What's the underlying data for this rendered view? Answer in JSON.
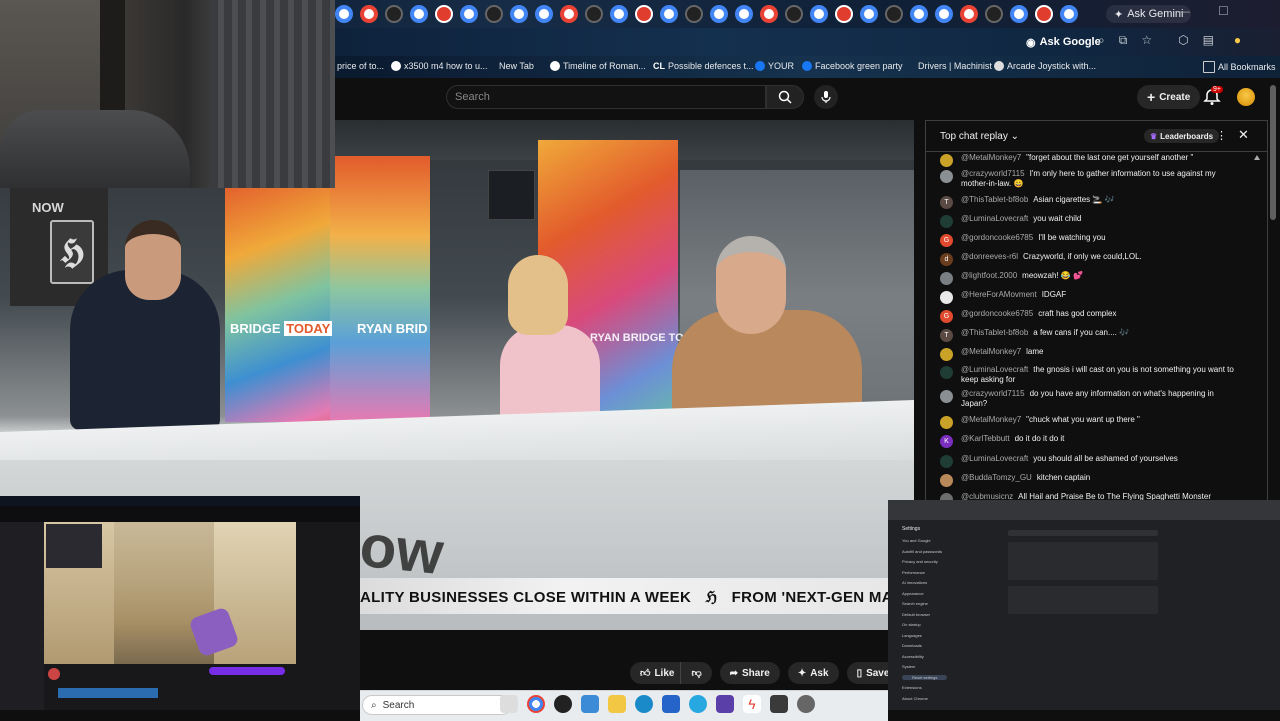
{
  "browser": {
    "tabs_count": 30,
    "ask_gemini": "Ask Gemini",
    "ask_google": "Ask Google",
    "bookmarks": [
      {
        "label": "price of to..."
      },
      {
        "label": "x3500 m4 how to u..."
      },
      {
        "label": "New Tab"
      },
      {
        "label": "Timeline of Roman..."
      },
      {
        "label": "Possible defences t..."
      },
      {
        "label": "YOUR"
      },
      {
        "label": "Facebook green party"
      },
      {
        "label": "Drivers | Machinist"
      },
      {
        "label": "Arcade Joystick with..."
      }
    ],
    "all_bookmarks": "All Bookmarks"
  },
  "youtube": {
    "search_placeholder": "Search",
    "create_label": "Create",
    "notif_badge": "9+"
  },
  "video": {
    "channel_logo": "NOW",
    "set_text_left": "BRIDGE",
    "set_text_today": "TODAY",
    "set_text_right": "RYAN BRID",
    "set_text_mid": "RYAN BRIDGE TO",
    "ticker": "ALITY BUSINESSES CLOSE WITHIN A WEEK",
    "ticker_right": "FROM 'NEXT-GEN MANU"
  },
  "actions": {
    "like": "Like",
    "share": "Share",
    "ask": "Ask",
    "save": "Save"
  },
  "chat": {
    "title": "Top chat replay",
    "leaderboards": "Leaderboards",
    "messages": [
      {
        "user": "@MetalMonkey7",
        "text": "\"forget about the last one get yourself another \"",
        "color": "#c9a227",
        "initial": ""
      },
      {
        "user": "@crazyworld7115",
        "text": "I'm only here to gather information to use against my mother-in-law. 😀",
        "color": "#8a8f94",
        "initial": ""
      },
      {
        "user": "@ThisTablet-bf8ob",
        "text": "Asian cigarettes 🚬 🎶",
        "color": "#5b4a44",
        "initial": "T"
      },
      {
        "user": "@LuminaLovecraft",
        "text": "you wait child",
        "color": "#1f3d35",
        "initial": ""
      },
      {
        "user": "@gordoncooke6785",
        "text": "I'll be watching you",
        "color": "#e04a2f",
        "initial": "G"
      },
      {
        "user": "@donreeves-r6l",
        "text": "Crazyworld, if only we could,LOL.",
        "color": "#6b3d1f",
        "initial": "d"
      },
      {
        "user": "@lightfoot.2000",
        "text": "meowzah! 😂 💕",
        "color": "#7a7f84",
        "initial": ""
      },
      {
        "user": "@HereForAMovment",
        "text": "IDGAF",
        "color": "#e8e8e8",
        "initial": ""
      },
      {
        "user": "@gordoncooke6785",
        "text": "craft has god complex",
        "color": "#e04a2f",
        "initial": "G"
      },
      {
        "user": "@ThisTablet-bf8ob",
        "text": "a few cans if you can.... 🎶",
        "color": "#5b4a44",
        "initial": "T"
      },
      {
        "user": "@MetalMonkey7",
        "text": "lame",
        "color": "#c9a227",
        "initial": ""
      },
      {
        "user": "@LuminaLovecraft",
        "text": "the gnosis i will cast on you is not something you want to keep asking for",
        "color": "#1f3d35",
        "initial": ""
      },
      {
        "user": "@crazyworld7115",
        "text": "do you have any information on what's happening in Japan?",
        "color": "#8a8f94",
        "initial": ""
      },
      {
        "user": "@MetalMonkey7",
        "text": "\"chuck what you want up there \"",
        "color": "#c9a227",
        "initial": ""
      },
      {
        "user": "@KarlTebbutt",
        "text": "do it do it do it",
        "color": "#7b2fbe",
        "initial": "K"
      },
      {
        "user": "@LuminaLovecraft",
        "text": "you should all be ashamed of yourselves",
        "color": "#1f3d35",
        "initial": ""
      },
      {
        "user": "@BuddaTomzy_GU",
        "text": "kitchen captain",
        "color": "#b9895a",
        "initial": ""
      },
      {
        "user": "@clubmusicnz",
        "text": "All Hail and Praise Be to The Flying Spaghetti Monster",
        "color": "#6d6d6d",
        "initial": ""
      }
    ]
  },
  "taskbar": {
    "search": "Search"
  },
  "settings": {
    "title": "Settings",
    "items": [
      "You and Google",
      "Autofill and passwords",
      "Privacy and security",
      "Performance",
      "AI innovations",
      "Appearance",
      "Search engine",
      "Default browser",
      "On startup",
      "Languages",
      "Downloads",
      "Accessibility",
      "System",
      "Reset settings",
      "Extensions",
      "About Chrome"
    ]
  }
}
